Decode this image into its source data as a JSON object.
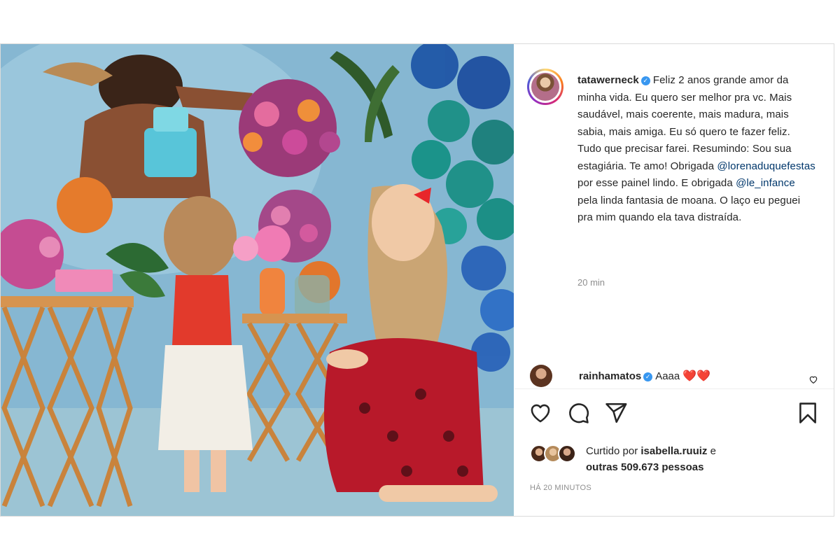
{
  "post": {
    "author": "tatawerneck",
    "verified_mark": "✓",
    "caption_parts": {
      "text1": "Feliz 2 anos grande amor da minha vida. Eu quero ser melhor pra vc. Mais saudável, mais coerente, mais madura, mais sabia, mais amiga. Eu só quero te fazer feliz. Tudo que precisar farei. Resumindo: Sou sua estagiária. Te amo! Obrigada ",
      "mention1": "@lorenaduquefestas",
      "text2": " por esse painel lindo. E obrigada ",
      "mention2": "@le_infance",
      "text3": " pela linda fantasia de moana. O laço eu peguei pra mim quando ela tava distraída."
    },
    "caption_time": "20 min",
    "timestamp": "HÁ 20 MINUTOS"
  },
  "comment": {
    "user": "rainhamatos",
    "verified_mark": "✓",
    "text": "Aaaa",
    "emoji": "❤️❤️"
  },
  "likes": {
    "prefix": "Curtido por",
    "user": "isabella.ruuiz",
    "conj": "e",
    "others": "outras 509.673 pessoas"
  },
  "icons": {
    "like": "heart-outline-icon",
    "comment": "comment-bubble-icon",
    "share": "paper-plane-icon",
    "save": "bookmark-icon"
  },
  "colors": {
    "verified": "#3897f0",
    "mention": "#00376b",
    "muted": "#8e8e8e",
    "heart": "#e0251b"
  }
}
